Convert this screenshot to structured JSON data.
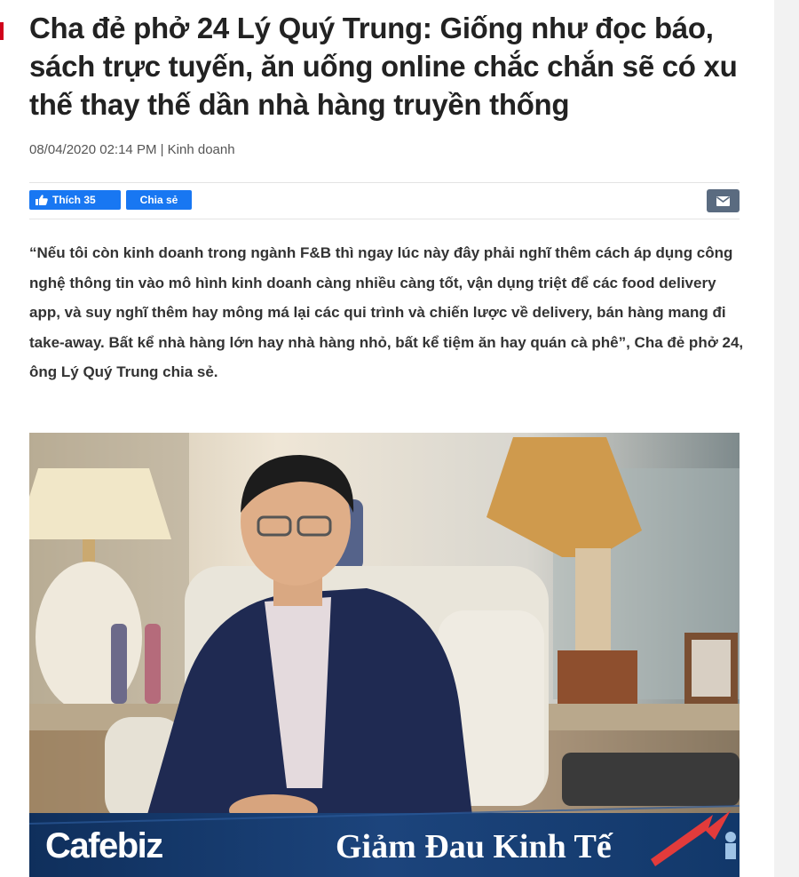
{
  "article": {
    "title": "Cha đẻ phở 24 Lý Quý Trung: Giống như đọc báo, sách trực tuyến, ăn uống online chắc chắn sẽ có xu thế thay thế dần nhà hàng truyền thống",
    "meta": "08/04/2020 02:14 PM | Kinh doanh",
    "sapo": "“Nếu tôi còn kinh doanh trong ngành F&B thì ngay lúc này đây phải nghĩ thêm cách áp dụng công nghệ thông tin vào mô hình kinh doanh càng nhiều càng tốt, vận dụng triệt để các food delivery app, và suy nghĩ thêm hay mông má lại các qui trình và chiến lược về delivery, bán hàng mang đi take-away. Bất kể nhà hàng lớn hay nhà hàng nhỏ, bất kể tiệm ăn hay quán cà phê”, Cha đẻ phở 24, ông Lý Quý Trung chia sẻ."
  },
  "share": {
    "like_label": "Thích 35",
    "share_label": "Chia sẻ",
    "like_icon": "thumbs-up-icon",
    "mail_icon": "mail-icon"
  },
  "image": {
    "brand": "Cafebiz",
    "slogan": "Giảm Đau Kinh Tế"
  },
  "colors": {
    "facebook": "#1877f2",
    "accent_red": "#d0021b",
    "mail": "#5a6b80",
    "banner": "#16396b"
  }
}
